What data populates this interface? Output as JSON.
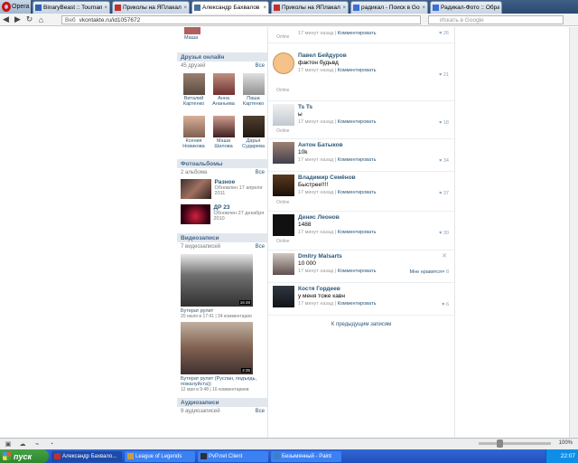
{
  "browser": {
    "menu_label": "Opera",
    "tabs": [
      {
        "title": "BinaryBeast :: Tourname...",
        "color": "#3060b0"
      },
      {
        "title": "Приколы на ЯПлакалъ",
        "color": "#c03030"
      },
      {
        "title": "Александр Бахвалов",
        "color": "#4a6f9a"
      },
      {
        "title": "Приколы на ЯПлакалъ ::",
        "color": "#c03030"
      },
      {
        "title": "радикал - Поиск в Google",
        "color": "#3b6fd8"
      },
      {
        "title": "Радикал-Фото :: Обраб...",
        "color": "#3b6fd8"
      }
    ],
    "address_prefix": "Веб",
    "address": "vkontakte.ru/id1057672",
    "search_placeholder": "Искать в Google"
  },
  "left": {
    "top_name": "Маша",
    "friends_online_title": "Друзья онлайн",
    "friends_count": "45 друзей",
    "all_label": "Все",
    "friends": [
      {
        "name": "Виталий Картенко"
      },
      {
        "name": "Анна Ананьева"
      },
      {
        "name": "Паша Картенко"
      },
      {
        "name": "Ксения Новикова"
      },
      {
        "name": "Маша Шилова"
      },
      {
        "name": "Дарья Сударева"
      }
    ],
    "photos_title": "Фотоальбомы",
    "albums_count": "2 альбома",
    "albums": [
      {
        "title": "Разное",
        "date": "Обновлен 17 апреля 2011"
      },
      {
        "title": "ДР 23",
        "date": "Обновлен 27 декабря 2010"
      }
    ],
    "videos_title": "Видеозаписи",
    "videos_count": "7 видеозаписей",
    "videos": [
      {
        "title": "Бутерат рулит",
        "meta": "20 июля в 17:41 | 34 комментария",
        "duration": "16:48"
      },
      {
        "title": "Бутерат рулит (Руслан, подъедь, пожалуйста))",
        "meta": "12 мая в 9:48 | 16 комментариев",
        "duration": "4:35"
      }
    ],
    "audio_title": "Аудиозаписи",
    "audio_count": "9 аудиозаписей"
  },
  "wall": {
    "top_meta": "17 минут назад",
    "top_comment": "Комментировать",
    "top_likes": "26",
    "posts": [
      {
        "name": "Павел Бейдуров",
        "text": "фактон будьвд",
        "time": "17 минут назад",
        "comment": "Комментировать",
        "likes": "21",
        "online": "Online"
      },
      {
        "name": "Ts Ts",
        "text": "ы",
        "time": "17 минут назад",
        "comment": "Комментировать",
        "likes": "18",
        "online": "Online"
      },
      {
        "name": "Антон Батыков",
        "text": "10k",
        "time": "17 минут назад",
        "comment": "Комментировать",
        "likes": "34",
        "online": ""
      },
      {
        "name": "Владимир Семёнов",
        "text": "Быстрее!!!!",
        "time": "17 минут назад",
        "comment": "Комментировать",
        "likes": "37",
        "online": "Online"
      },
      {
        "name": "Денис Леонов",
        "text": "1488",
        "time": "17 минут назад",
        "comment": "Комментировать",
        "likes": "30",
        "online": "Online"
      },
      {
        "name": "Dmitry Malsarts",
        "text": "10 000",
        "time": "17 минут назад",
        "comment": "Комментировать",
        "likes": "8",
        "online": "",
        "likes_text": "Мне нравится"
      },
      {
        "name": "Костя Гордеев",
        "text": "у меня тоже кавн",
        "time": "17 минут назад",
        "comment": "Комментировать",
        "likes": "6",
        "online": ""
      }
    ],
    "prev_link": "К предыдущим записям",
    "online_label": "Online"
  },
  "status": {
    "zoom": "100%"
  },
  "taskbar": {
    "start_label": "пуск",
    "items": [
      {
        "title": "Александр Бахвало...",
        "color": "#c03030"
      },
      {
        "title": "League of Legends",
        "color": "#c8a040"
      },
      {
        "title": "PvP.net Client",
        "color": "#303030"
      },
      {
        "title": "Безымянный - Paint",
        "color": "#4080c0"
      }
    ],
    "clock": "22:07"
  }
}
